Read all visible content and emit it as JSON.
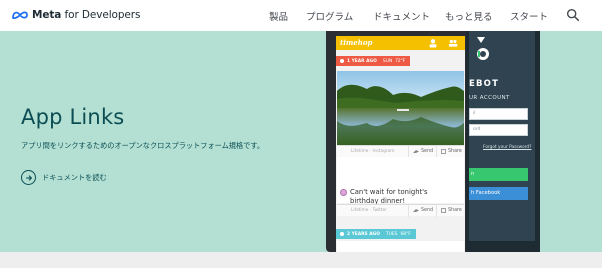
{
  "brand": {
    "name_bold": "Meta",
    "name_rest": " for Developers"
  },
  "nav": {
    "items": [
      {
        "label": "製品"
      },
      {
        "label": "プログラム"
      },
      {
        "label": "ドキュメント"
      },
      {
        "label": "もっと見る"
      },
      {
        "label": "スタート"
      }
    ],
    "search_icon": "search-icon"
  },
  "hero": {
    "title": "App Links",
    "description": "アプリ間をリンクするためのオープンなクロスプラットフォーム規格です。",
    "link_label": "ドキュメントを読む",
    "background": "#b3e0d3",
    "text_color": "#0b4d53"
  },
  "phone_left": {
    "app_name": "timehop",
    "tag1": {
      "age": "1 YEAR AGO",
      "day": "SUN",
      "weather": "72°F",
      "color": "#ee5a44"
    },
    "tag2": {
      "age": "2 YEARS AGO",
      "day": "TUES",
      "weather": "68°F",
      "color": "#5bc8d6"
    },
    "photo_caption": "Lifetime · Instagram",
    "send_label": "Send",
    "share_label": "Share",
    "post_text": "Can't wait for tonight's birthday dinner!",
    "post_caption": "Lifetime · Twitter"
  },
  "phone_right": {
    "title": "EBOT",
    "account_label": "UR ACCOUNT",
    "field1": "il",
    "field2": "ord",
    "forgot": "Forgot your Password?",
    "btn_green": "n",
    "btn_fb": "h Facebook"
  }
}
